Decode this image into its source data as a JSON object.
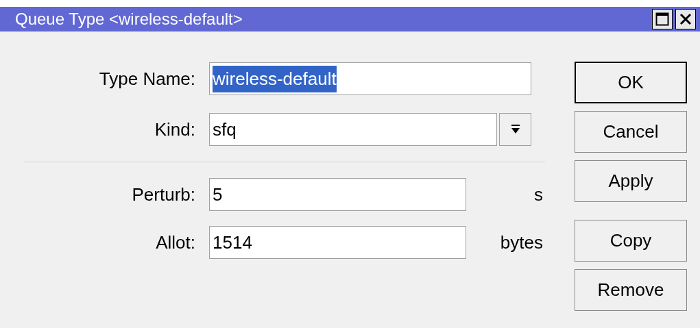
{
  "window": {
    "title": "Queue Type <wireless-default>"
  },
  "sections": [
    [
      {
        "label": "Type Name:",
        "value": "wireless-default",
        "kind": "text",
        "selected": true
      },
      {
        "label": "Kind:",
        "value": "sfq",
        "kind": "dropdown",
        "selected": false
      }
    ],
    [
      {
        "label": "Perturb:",
        "value": "5",
        "kind": "text",
        "unit": "s",
        "selected": false
      },
      {
        "label": "Allot:",
        "value": "1514",
        "kind": "text",
        "unit": "bytes",
        "selected": false
      }
    ]
  ],
  "button_groups": [
    [
      {
        "label": "OK",
        "default": true
      },
      {
        "label": "Cancel",
        "default": false
      },
      {
        "label": "Apply",
        "default": false
      }
    ],
    [
      {
        "label": "Copy",
        "default": false
      },
      {
        "label": "Remove",
        "default": false
      }
    ]
  ]
}
